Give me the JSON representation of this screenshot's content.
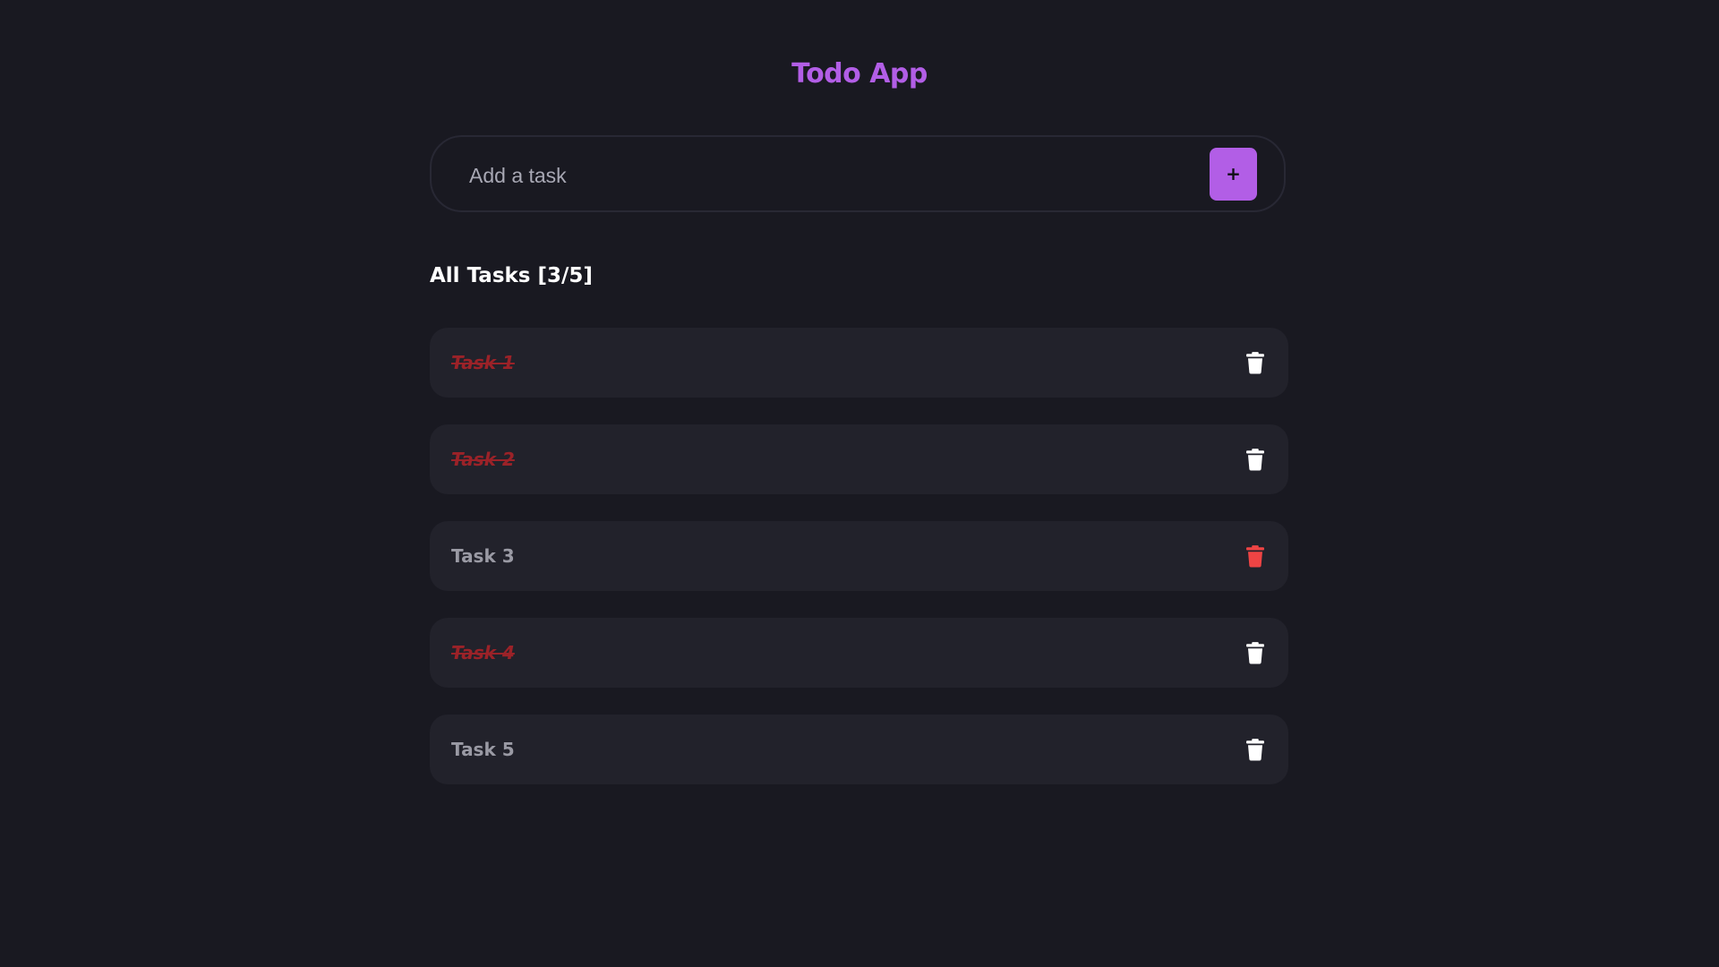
{
  "header": {
    "title": "Todo App"
  },
  "add_task": {
    "placeholder": "Add a task",
    "value": "",
    "button_label": "+"
  },
  "task_list": {
    "heading": "All Tasks [3/5]",
    "items": [
      {
        "label": "Task 1",
        "completed": true,
        "delete_icon": "trash-icon",
        "delete_icon_color": "#ffffff"
      },
      {
        "label": "Task 2",
        "completed": true,
        "delete_icon": "trash-icon",
        "delete_icon_color": "#ffffff"
      },
      {
        "label": "Task 3",
        "completed": false,
        "delete_icon": "trash-icon",
        "delete_icon_color": "#ef4444"
      },
      {
        "label": "Task 4",
        "completed": true,
        "delete_icon": "trash-icon",
        "delete_icon_color": "#ffffff"
      },
      {
        "label": "Task 5",
        "completed": false,
        "delete_icon": "trash-icon",
        "delete_icon_color": "#ffffff"
      }
    ]
  },
  "colors": {
    "background": "#191921",
    "accent": "#b25ee6",
    "card": "#22222b",
    "completed_text": "#9b2228",
    "pending_text": "#9a9aa4",
    "delete_hover": "#ef4444"
  }
}
